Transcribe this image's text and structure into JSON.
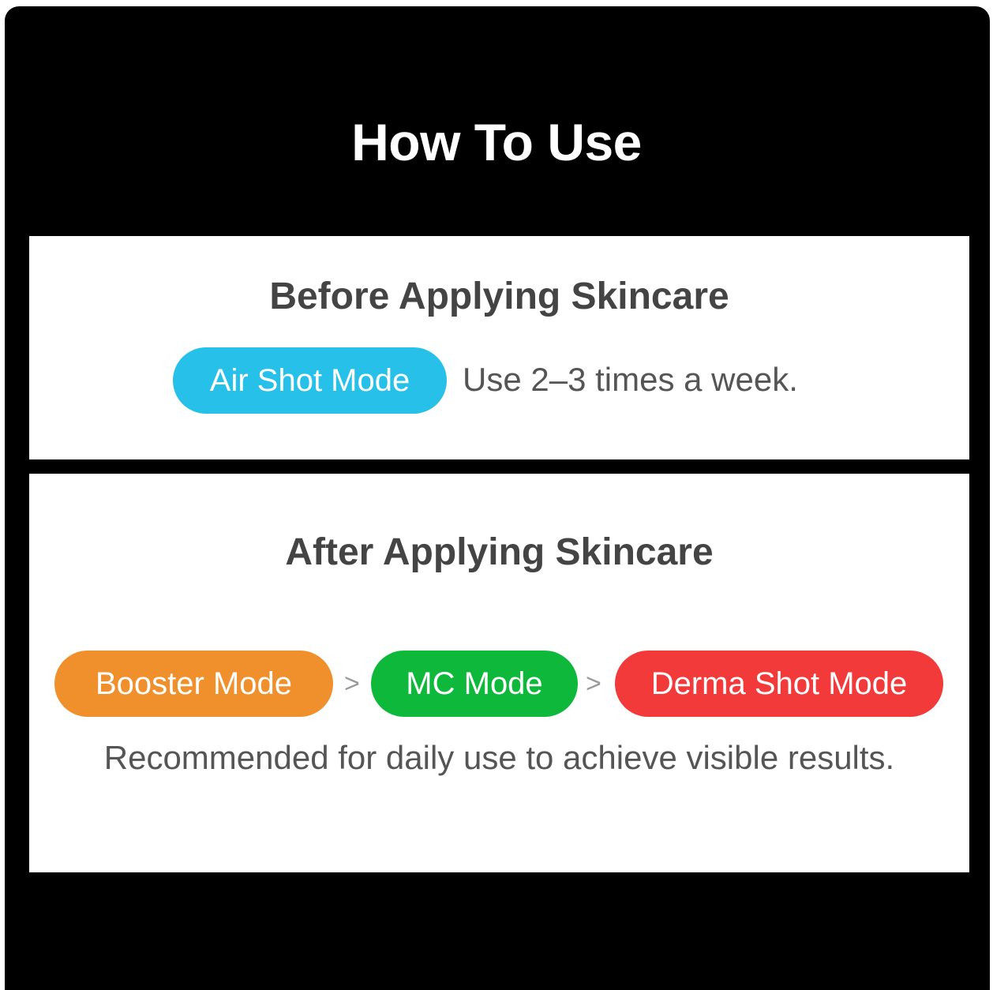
{
  "title": "How To Use",
  "before": {
    "heading": "Before Applying Skincare",
    "mode": {
      "label": "Air Shot Mode",
      "color": "#27c0e8"
    },
    "usage": "Use 2–3 times a week."
  },
  "after": {
    "heading": "After Applying Skincare",
    "modes": [
      {
        "label": "Booster Mode",
        "color": "#ef902c"
      },
      {
        "label": "MC Mode",
        "color": "#0db83a"
      },
      {
        "label": "Derma Shot Mode",
        "color": "#f33a3a"
      }
    ],
    "separator": ">",
    "recommendation": "Recommended for daily use to achieve visible results."
  }
}
